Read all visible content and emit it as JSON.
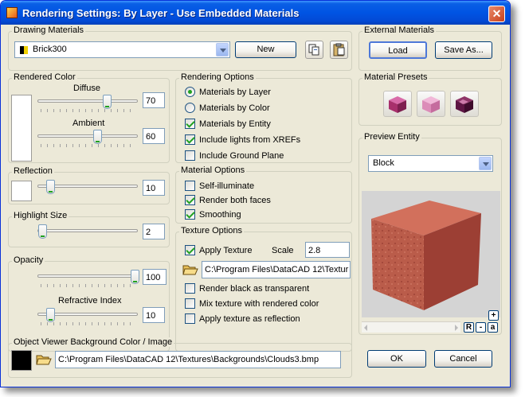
{
  "window": {
    "title": "Rendering Settings: By Layer - Use Embedded Materials",
    "close_label": "✕"
  },
  "drawing_materials": {
    "legend": "Drawing Materials",
    "selected": "Brick300",
    "new_label": "New"
  },
  "external_materials": {
    "legend": "External Materials",
    "load_label": "Load",
    "save_as_label": "Save As..."
  },
  "rendered_color": {
    "legend": "Rendered Color",
    "diffuse_label": "Diffuse",
    "diffuse_value": "70",
    "diffuse_level": 70,
    "ambient_label": "Ambient",
    "ambient_value": "60",
    "ambient_level": 60,
    "swatch_color": "#ffffff"
  },
  "reflection": {
    "legend": "Reflection",
    "value": "10",
    "level": 10,
    "swatch_color": "#ffffff"
  },
  "highlight_size": {
    "legend": "Highlight Size",
    "value": "2",
    "level": 2
  },
  "opacity": {
    "legend": "Opacity",
    "value": "100",
    "level": 100,
    "refractive_label": "Refractive Index",
    "refractive_value": "10",
    "refractive_level": 10
  },
  "rendering_options": {
    "legend": "Rendering Options",
    "by_layer": "Materials by Layer",
    "by_color": "Materials by Color",
    "selected": "by_layer",
    "by_entity": "Materials by Entity",
    "by_entity_checked": true,
    "include_lights": "Include lights from XREFs",
    "include_lights_checked": true,
    "include_ground": "Include Ground Plane",
    "include_ground_checked": false
  },
  "material_options": {
    "legend": "Material Options",
    "self_illuminate": "Self-illuminate",
    "self_illuminate_checked": false,
    "render_both": "Render both faces",
    "render_both_checked": true,
    "smoothing": "Smoothing",
    "smoothing_checked": true
  },
  "texture_options": {
    "legend": "Texture Options",
    "apply_texture": "Apply Texture",
    "apply_texture_checked": true,
    "scale_label": "Scale",
    "scale_value": "2.8",
    "path": "C:\\Program Files\\DataCAD 12\\Textur",
    "render_black": "Render black as transparent",
    "render_black_checked": false,
    "mix_texture": "Mix texture with rendered color",
    "mix_texture_checked": false,
    "apply_reflection": "Apply texture as reflection",
    "apply_reflection_checked": false
  },
  "material_presets": {
    "legend": "Material Presets",
    "icons": [
      "cube-red-preset-icon",
      "cube-pink-preset-icon",
      "cube-dark-preset-icon"
    ]
  },
  "preview_entity": {
    "legend": "Preview Entity",
    "selected": "Block",
    "zoom_in": "+",
    "reset": "R",
    "zoom_out": "-",
    "auto": "a"
  },
  "background": {
    "legend": "Object Viewer Background Color / Image",
    "color": "#000000",
    "path": "C:\\Program Files\\DataCAD 12\\Textures\\Backgrounds\\Clouds3.bmp"
  },
  "footer": {
    "ok_label": "OK",
    "cancel_label": "Cancel"
  },
  "colors": {
    "titlebar": "#0054e3",
    "dialog_bg": "#ece9d8",
    "check_green": "#21a121",
    "cube_face": "#c0584a"
  }
}
